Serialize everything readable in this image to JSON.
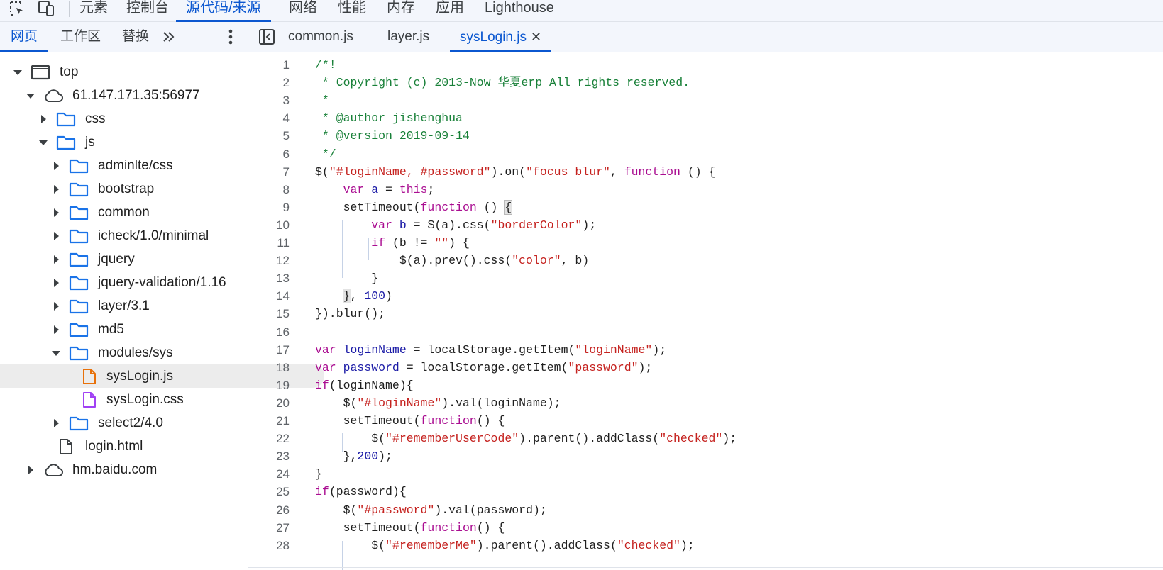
{
  "main_toolbar": {
    "tabs": [
      {
        "label": "元素"
      },
      {
        "label": "控制台"
      },
      {
        "label": "源代码/来源"
      },
      {
        "label": "网络"
      },
      {
        "label": "性能"
      },
      {
        "label": "内存"
      },
      {
        "label": "应用"
      },
      {
        "label": "Lighthouse"
      }
    ],
    "active_tab": "源代码/来源",
    "icons": [
      "inspect-element-icon",
      "device-toolbar-icon"
    ],
    "accent_color": "#0b57d0"
  },
  "navigator": {
    "tabs": [
      {
        "label": "网页"
      },
      {
        "label": "工作区"
      },
      {
        "label": "替换"
      }
    ],
    "active_tab": "网页",
    "more_label": "»",
    "tree": [
      {
        "label": "top",
        "icon": "frame-icon",
        "expanded": true
      },
      {
        "label": "61.147.171.35:56977",
        "icon": "cloud-icon",
        "expanded": true
      },
      {
        "label": "css",
        "icon": "folder-icon",
        "expanded": false
      },
      {
        "label": "js",
        "icon": "folder-icon",
        "expanded": true
      },
      {
        "label": "adminlte/css",
        "icon": "folder-icon",
        "expanded": false
      },
      {
        "label": "bootstrap",
        "icon": "folder-icon",
        "expanded": false
      },
      {
        "label": "common",
        "icon": "folder-icon",
        "expanded": false
      },
      {
        "label": "icheck/1.0/minimal",
        "icon": "folder-icon",
        "expanded": false
      },
      {
        "label": "jquery",
        "icon": "folder-icon",
        "expanded": false
      },
      {
        "label": "jquery-validation/1.16",
        "icon": "folder-icon",
        "expanded": false
      },
      {
        "label": "layer/3.1",
        "icon": "folder-icon",
        "expanded": false
      },
      {
        "label": "md5",
        "icon": "folder-icon",
        "expanded": false
      },
      {
        "label": "modules/sys",
        "icon": "folder-icon",
        "expanded": true
      },
      {
        "label": "sysLogin.js",
        "icon": "js-file-icon",
        "selected": true
      },
      {
        "label": "sysLogin.css",
        "icon": "css-file-icon"
      },
      {
        "label": "select2/4.0",
        "icon": "folder-icon",
        "expanded": false
      },
      {
        "label": "login.html",
        "icon": "document-file-icon"
      },
      {
        "label": "hm.baidu.com",
        "icon": "cloud-icon",
        "expanded": false
      }
    ]
  },
  "editor": {
    "tabs": [
      {
        "label": "common.js"
      },
      {
        "label": "layer.js"
      },
      {
        "label": "sysLogin.js",
        "closable": true
      }
    ],
    "active_tab": "sysLogin.js",
    "close_glyph": "✕",
    "line_numbers": [
      "1",
      "2",
      "3",
      "4",
      "5",
      "6",
      "7",
      "8",
      "9",
      "10",
      "11",
      "12",
      "13",
      "14",
      "15",
      "16",
      "17",
      "18",
      "19",
      "20",
      "21",
      "22",
      "23",
      "24",
      "25",
      "26",
      "27",
      "28"
    ],
    "code_lines": [
      "/*!",
      " * Copyright (c) 2013-Now 华夏erp All rights reserved.",
      " *",
      " * @author jishenghua",
      " * @version 2019-09-14",
      " */",
      "$(\"#loginName, #password\").on(\"focus blur\", function () {",
      "    var a = this;",
      "    setTimeout(function () {",
      "        var b = $(a).css(\"borderColor\");",
      "        if (b != \"\") {",
      "            $(a).prev().css(\"color\", b)",
      "        }",
      "    }, 100)",
      "}).blur();",
      "",
      "var loginName = localStorage.getItem(\"loginName\");",
      "var password = localStorage.getItem(\"password\");",
      "if(loginName){",
      "    $(\"#loginName\").val(loginName);",
      "    setTimeout(function() {",
      "        $(\"#rememberUserCode\").parent().addClass(\"checked\");",
      "    },200);",
      "}",
      "if(password){",
      "    $(\"#password\").val(password);",
      "    setTimeout(function() {",
      "        $(\"#rememberMe\").parent().addClass(\"checked\");"
    ],
    "syntax_colors": {
      "comment": "#188038",
      "keyword": "#aa0d91",
      "string": "#c5221f",
      "variable": "#1a1aa6"
    }
  }
}
